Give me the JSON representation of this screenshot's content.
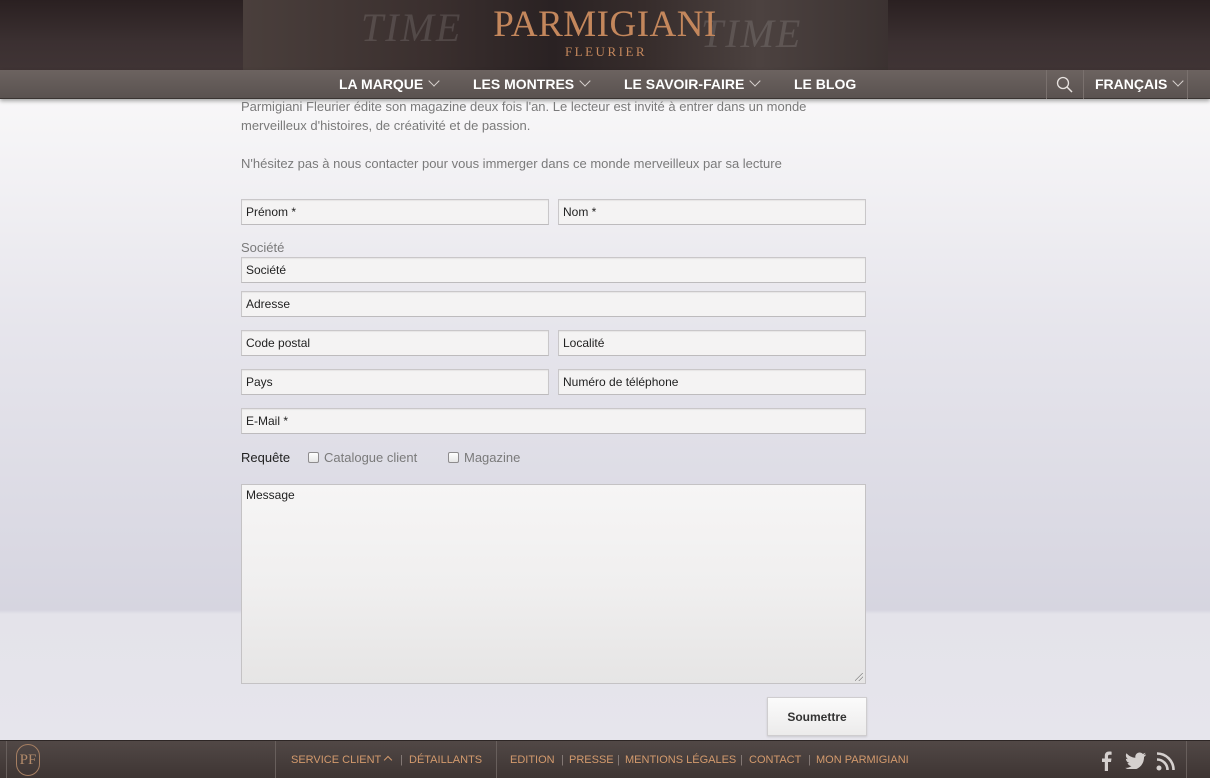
{
  "header": {
    "brand": "PARMIGIANI",
    "sub_brand": "FLEURIER",
    "hero_ghost_left": "TIME",
    "hero_ghost_right": "TIME"
  },
  "nav": {
    "items": [
      {
        "label": "LA MARQUE",
        "has_dropdown": true
      },
      {
        "label": "LES MONTRES",
        "has_dropdown": true
      },
      {
        "label": "LE SAVOIR-FAIRE",
        "has_dropdown": true
      },
      {
        "label": "LE BLOG",
        "has_dropdown": false
      }
    ],
    "search_icon": "search-icon",
    "language": "FRANÇAIS"
  },
  "intro": {
    "paragraph1": "Parmigiani Fleurier édite son magazine deux fois l'an. Le lecteur est invité à entrer dans un monde merveilleux d'histoires, de créativité et de passion.",
    "paragraph2": "N'hésitez pas à nous contacter pour vous immerger dans ce monde merveilleux par sa lecture"
  },
  "form": {
    "prenom": "Prénom *",
    "nom": "Nom *",
    "societe_label": "Société",
    "societe": "Société",
    "adresse": "Adresse",
    "code_postal": "Code postal",
    "localite": "Localité",
    "pays": "Pays",
    "telephone": "Numéro de téléphone",
    "email": "E-Mail *",
    "requete_label": "Requête",
    "options": [
      {
        "label": "Catalogue client",
        "checked": false
      },
      {
        "label": "Magazine",
        "checked": false
      }
    ],
    "message": "Message",
    "submit": "Soumettre"
  },
  "footer": {
    "logo": "PF",
    "service_client": "SERVICE CLIENT",
    "detaillants": "DÉTAILLANTS",
    "links": [
      "EDITION",
      "PRESSE",
      "MENTIONS LÉGALES",
      "CONTACT",
      "MON PARMIGIANI"
    ],
    "social_icons": [
      "facebook-icon",
      "twitter-icon",
      "rss-icon"
    ],
    "accent_color": "#d39a6d"
  }
}
